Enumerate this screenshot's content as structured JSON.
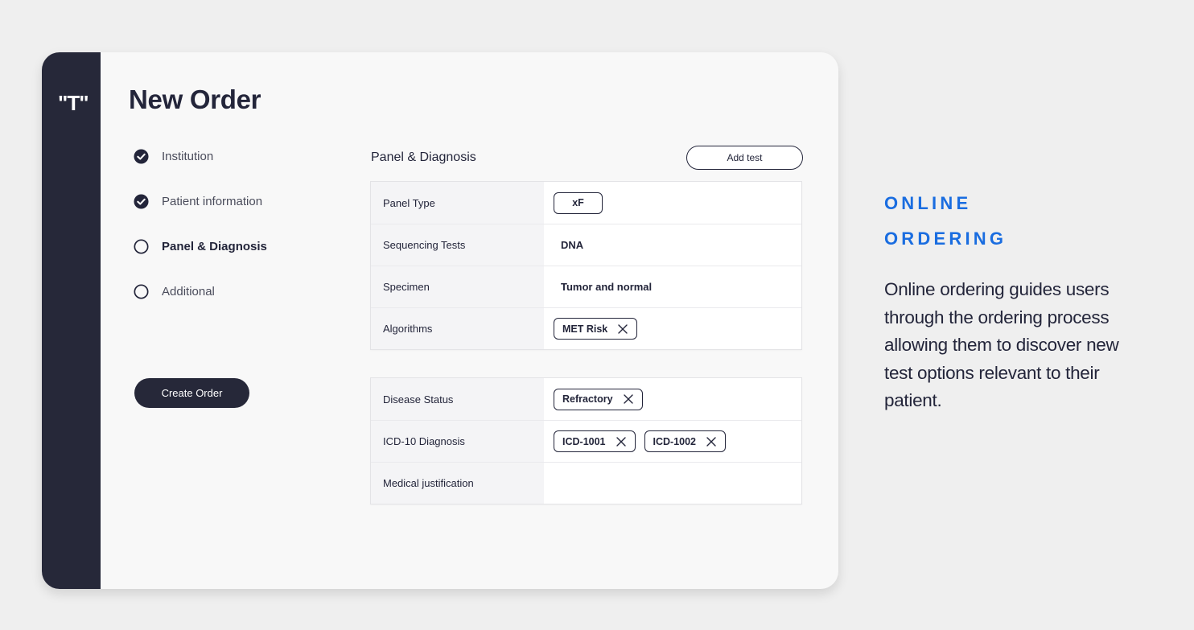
{
  "app": {
    "logo_text": "\"T\"",
    "title": "New Order"
  },
  "steps": [
    {
      "label": "Institution",
      "state": "complete",
      "icon": "check-circle-icon"
    },
    {
      "label": "Patient information",
      "state": "complete",
      "icon": "check-circle-icon"
    },
    {
      "label": "Panel & Diagnosis",
      "state": "current",
      "icon": "empty-circle-icon"
    },
    {
      "label": "Additional",
      "state": "pending",
      "icon": "empty-circle-icon"
    }
  ],
  "actions": {
    "create_order_label": "Create Order",
    "add_test_label": "Add test"
  },
  "section": {
    "title": "Panel & Diagnosis"
  },
  "panel_table": {
    "rows": [
      {
        "label": "Panel Type",
        "chips": [
          "xF"
        ],
        "removable": false
      },
      {
        "label": "Sequencing Tests",
        "value": "DNA"
      },
      {
        "label": "Specimen",
        "value": "Tumor and normal"
      },
      {
        "label": "Algorithms",
        "chips": [
          "MET Risk"
        ],
        "removable": true
      }
    ]
  },
  "diagnosis_table": {
    "rows": [
      {
        "label": "Disease Status",
        "chips": [
          "Refractory"
        ],
        "removable": true
      },
      {
        "label": "ICD-10 Diagnosis",
        "chips": [
          "ICD-1001",
          "ICD-1002"
        ],
        "removable": true
      },
      {
        "label": "Medical justification",
        "value": ""
      }
    ]
  },
  "promo": {
    "heading_line1": "ONLINE",
    "heading_line2": "ORDERING",
    "body": "Online ordering guides users through the ordering process allowing them to discover new test options relevant to their patient."
  },
  "colors": {
    "sidebar": "#262839",
    "accent_blue": "#1a6de0",
    "text_dark": "#23253a",
    "background": "#efefef"
  }
}
